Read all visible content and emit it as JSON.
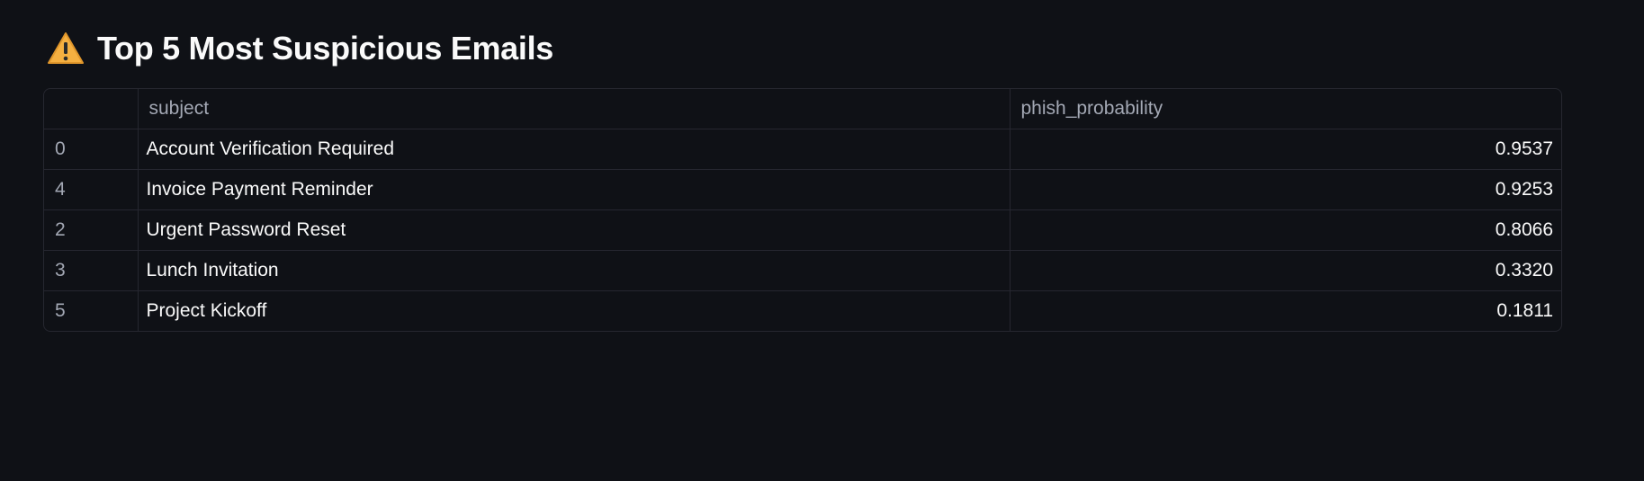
{
  "heading": {
    "icon": "warning-icon",
    "title": "Top 5 Most Suspicious Emails"
  },
  "table": {
    "columns": {
      "index": "",
      "subject": "subject",
      "phish_probability": "phish_probability"
    },
    "rows": [
      {
        "index": "0",
        "subject": "Account Verification Required",
        "phish_probability": "0.9537"
      },
      {
        "index": "4",
        "subject": "Invoice Payment Reminder",
        "phish_probability": "0.9253"
      },
      {
        "index": "2",
        "subject": "Urgent Password Reset",
        "phish_probability": "0.8066"
      },
      {
        "index": "3",
        "subject": "Lunch Invitation",
        "phish_probability": "0.3320"
      },
      {
        "index": "5",
        "subject": "Project Kickoff",
        "phish_probability": "0.1811"
      }
    ]
  },
  "colors": {
    "background": "#0f1116",
    "border": "#262730",
    "header_text": "#a3a8b4",
    "body_text": "#fafafa",
    "warning": "#f5b041"
  }
}
